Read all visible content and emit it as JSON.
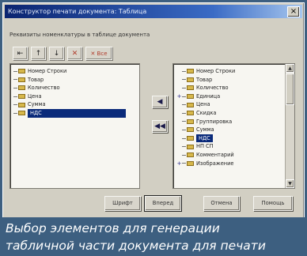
{
  "window": {
    "title": "Конструктор печати документа: Таблица",
    "close": "×"
  },
  "caption": "Реквизиты номенклатуры в таблице документа",
  "toolbar": [
    {
      "glyph": "⇤",
      "name": "move-first-button"
    },
    {
      "glyph": "↑",
      "name": "move-up-button"
    },
    {
      "glyph": "↓",
      "name": "move-down-button"
    },
    {
      "glyph": "✕",
      "name": "delete-button"
    },
    {
      "glyph": "✕ Все",
      "name": "delete-all-button"
    }
  ],
  "left_items": [
    {
      "label": "Номер Строки"
    },
    {
      "label": "Товар"
    },
    {
      "label": "Количество"
    },
    {
      "label": "Цена"
    },
    {
      "label": "Сумма"
    },
    {
      "label": "НДС"
    }
  ],
  "right_items": [
    {
      "label": "Номер Строки",
      "exp": ""
    },
    {
      "label": "Товар",
      "exp": ""
    },
    {
      "label": "Количество",
      "exp": ""
    },
    {
      "label": "Единица",
      "exp": "+"
    },
    {
      "label": "Цена",
      "exp": ""
    },
    {
      "label": "Скидка",
      "exp": ""
    },
    {
      "label": "Группировка",
      "exp": ""
    },
    {
      "label": "Сумма",
      "exp": ""
    },
    {
      "label": "НДС",
      "exp": ""
    },
    {
      "label": "НП СП",
      "exp": ""
    },
    {
      "label": "Комментарий",
      "exp": ""
    },
    {
      "label": "Изображение",
      "exp": "+"
    }
  ],
  "left_selected_index": 5,
  "right_selected_index": 8,
  "mid_buttons": {
    "add": "◀",
    "remove": "◀◀"
  },
  "buttons": {
    "b1": "Шрифт",
    "b2": "Вперед",
    "b3": "Отмена",
    "b4": "Помощь"
  },
  "bottom_caption": {
    "line1": "Выбор элементов для генерации",
    "line2": "табличной части документа для печати"
  }
}
